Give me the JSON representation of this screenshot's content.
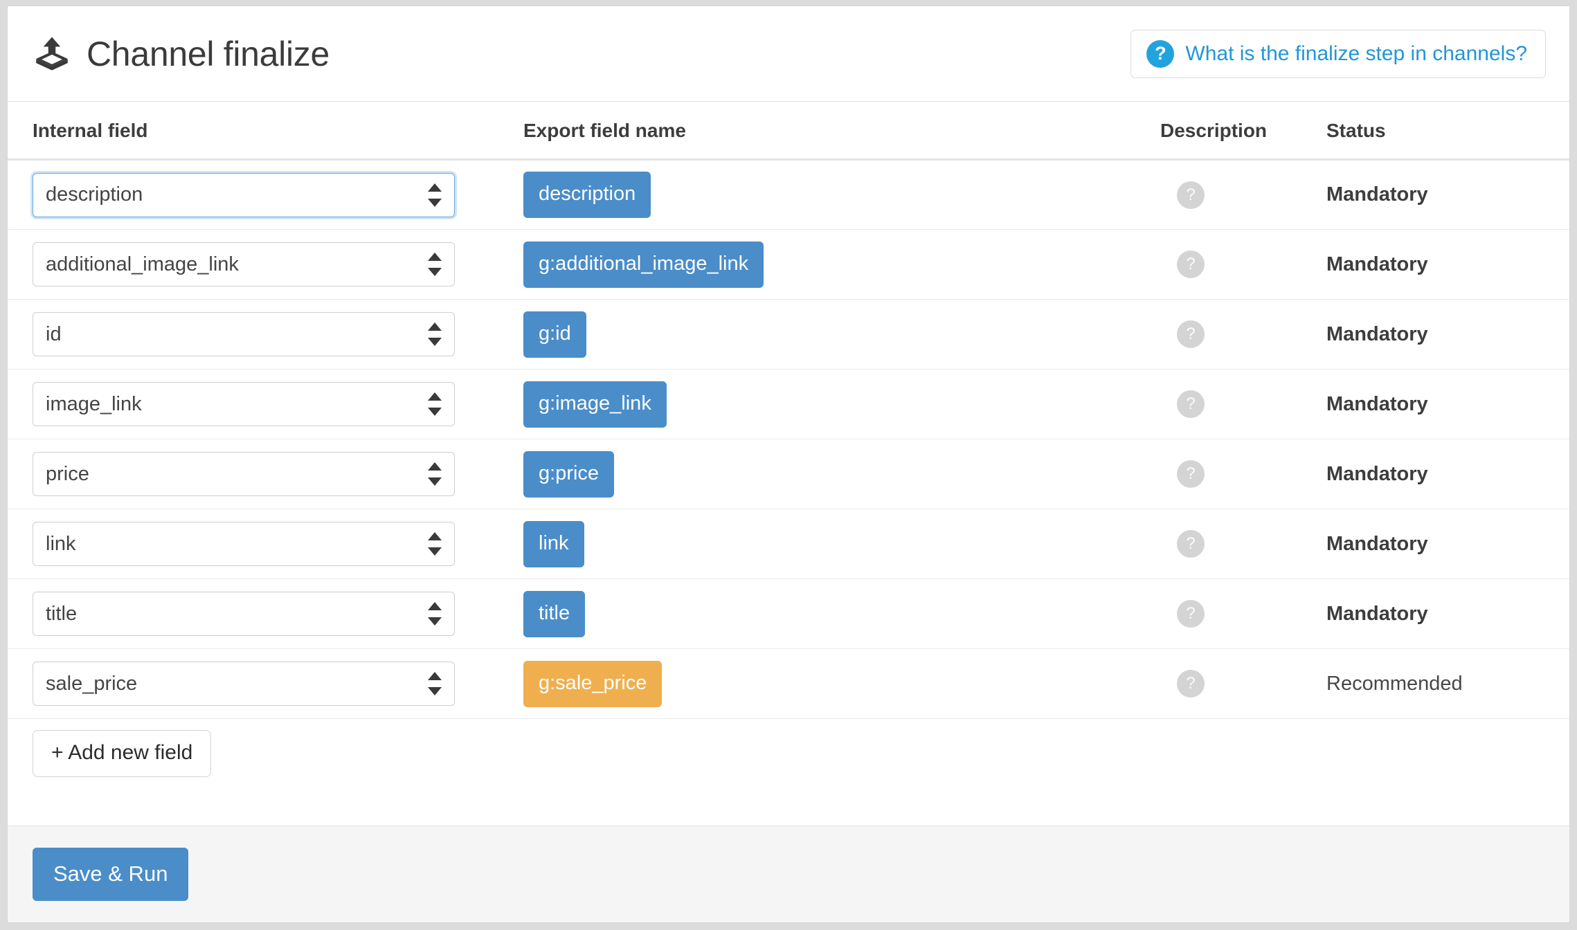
{
  "header": {
    "title": "Channel finalize",
    "brand_icon": "export-box-icon",
    "help_link": {
      "icon": "question-mark-circle-icon",
      "label": "What is the finalize step in channels?",
      "color": "#2196d8"
    }
  },
  "table": {
    "columns": [
      "Internal field",
      "Export field name",
      "Description",
      "Status"
    ],
    "description_icon": "?",
    "rows": [
      {
        "internal_field": "description",
        "export_field": "description",
        "export_color": "#4a8dc9",
        "status": "Mandatory",
        "focused": true
      },
      {
        "internal_field": "additional_image_link",
        "export_field": "g:additional_image_link",
        "export_color": "#4a8dc9",
        "status": "Mandatory",
        "focused": false
      },
      {
        "internal_field": "id",
        "export_field": "g:id",
        "export_color": "#4a8dc9",
        "status": "Mandatory",
        "focused": false
      },
      {
        "internal_field": "image_link",
        "export_field": "g:image_link",
        "export_color": "#4a8dc9",
        "status": "Mandatory",
        "focused": false
      },
      {
        "internal_field": "price",
        "export_field": "g:price",
        "export_color": "#4a8dc9",
        "status": "Mandatory",
        "focused": false
      },
      {
        "internal_field": "link",
        "export_field": "link",
        "export_color": "#4a8dc9",
        "status": "Mandatory",
        "focused": false
      },
      {
        "internal_field": "title",
        "export_field": "title",
        "export_color": "#4a8dc9",
        "status": "Mandatory",
        "focused": false
      },
      {
        "internal_field": "sale_price",
        "export_field": "g:sale_price",
        "export_color": "#efaf4e",
        "status": "Recommended",
        "focused": false
      }
    ]
  },
  "actions": {
    "add_new_field": "+ Add new field",
    "save_and_run": "Save & Run"
  }
}
